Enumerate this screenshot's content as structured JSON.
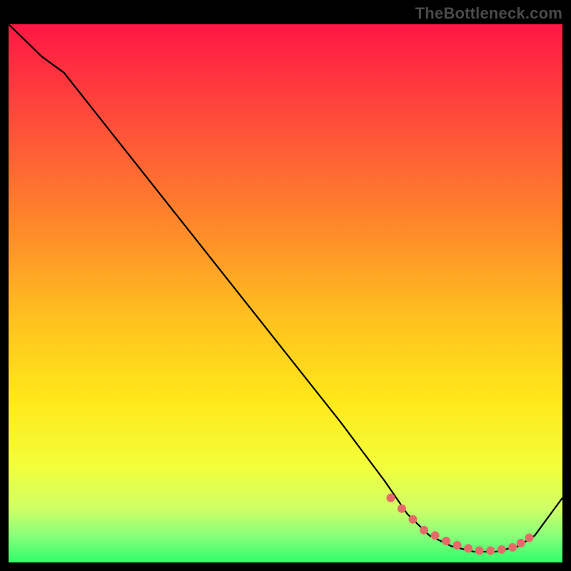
{
  "watermark": "TheBottleneck.com",
  "chart_data": {
    "type": "line",
    "title": "",
    "xlabel": "",
    "ylabel": "",
    "xlim": [
      0,
      100
    ],
    "ylim": [
      0,
      100
    ],
    "grid": false,
    "legend": false,
    "series": [
      {
        "name": "curve",
        "color": "#000000",
        "x": [
          0,
          6,
          10,
          20,
          30,
          40,
          50,
          60,
          68,
          72,
          76,
          80,
          84,
          88,
          92,
          95,
          100
        ],
        "y": [
          100,
          94,
          91,
          78,
          65,
          52,
          39,
          26,
          15,
          9,
          5,
          3,
          2,
          2,
          3,
          5,
          12
        ]
      }
    ],
    "markers": {
      "name": "minimum-region",
      "color": "#e66a6a",
      "x": [
        69,
        71,
        73,
        75,
        77,
        79,
        81,
        83,
        85,
        87,
        89,
        91,
        92.5,
        94
      ],
      "y": [
        12,
        10,
        8,
        6,
        5,
        4,
        3.2,
        2.6,
        2.2,
        2.2,
        2.4,
        2.8,
        3.6,
        4.6
      ]
    },
    "gradient_stops": [
      {
        "offset": 0.0,
        "color": "#ff1744"
      },
      {
        "offset": 0.18,
        "color": "#ff4d3a"
      },
      {
        "offset": 0.38,
        "color": "#ff8a2a"
      },
      {
        "offset": 0.55,
        "color": "#ffc21f"
      },
      {
        "offset": 0.7,
        "color": "#ffe81a"
      },
      {
        "offset": 0.82,
        "color": "#f3ff3a"
      },
      {
        "offset": 0.9,
        "color": "#cfff66"
      },
      {
        "offset": 0.95,
        "color": "#8aff7a"
      },
      {
        "offset": 1.0,
        "color": "#2fff6b"
      }
    ]
  }
}
